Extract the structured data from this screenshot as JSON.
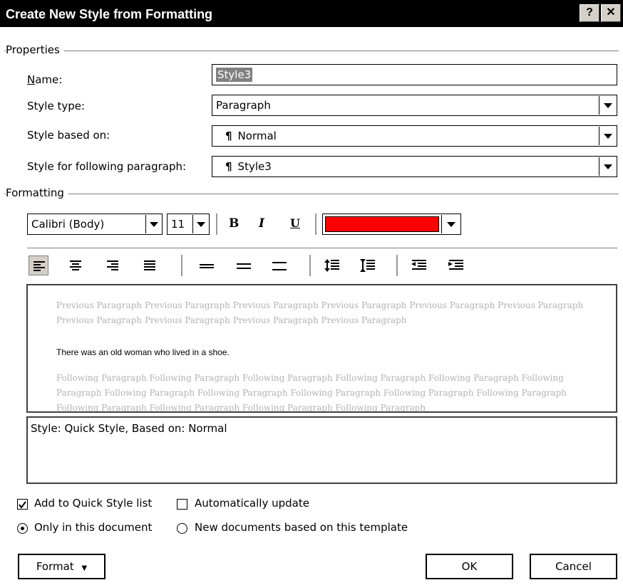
{
  "window": {
    "title": "Create New Style from Formatting",
    "help_label": "?",
    "close_label": "✕"
  },
  "properties": {
    "group_label": "Properties",
    "name_label": "Name:",
    "name_value": "Style3",
    "style_type_label": "Style type:",
    "style_type_value": "Paragraph",
    "based_on_label": "Style based on:",
    "based_on_value": "Normal",
    "following_label": "Style for following paragraph:",
    "following_value": "Style3",
    "pilcrow": "¶"
  },
  "formatting": {
    "group_label": "Formatting",
    "font": "Calibri (Body)",
    "size": "11",
    "bold": "B",
    "italic": "I",
    "underline": "U",
    "font_color": "#ff0000"
  },
  "preview": {
    "previous": "Previous Paragraph Previous Paragraph Previous Paragraph Previous Paragraph Previous Paragraph Previous Paragraph Previous Paragraph Previous Paragraph Previous Paragraph Previous Paragraph",
    "sample": "There was an old woman who lived in a shoe.",
    "following": "Following Paragraph Following Paragraph Following Paragraph Following Paragraph Following Paragraph Following Paragraph Following Paragraph Following Paragraph Following Paragraph Following Paragraph Following Paragraph Following Paragraph Following Paragraph Following Paragraph Following Paragraph"
  },
  "description": "Style: Quick Style, Based on: Normal",
  "options": {
    "add_quick_style": "Add to Quick Style list",
    "add_quick_style_checked": true,
    "auto_update": "Automatically update",
    "auto_update_checked": false,
    "only_this_doc": "Only in this document",
    "new_docs": "New documents based on this template",
    "selected_scope": "only_this_doc"
  },
  "buttons": {
    "format": "Format",
    "ok": "OK",
    "cancel": "Cancel"
  }
}
